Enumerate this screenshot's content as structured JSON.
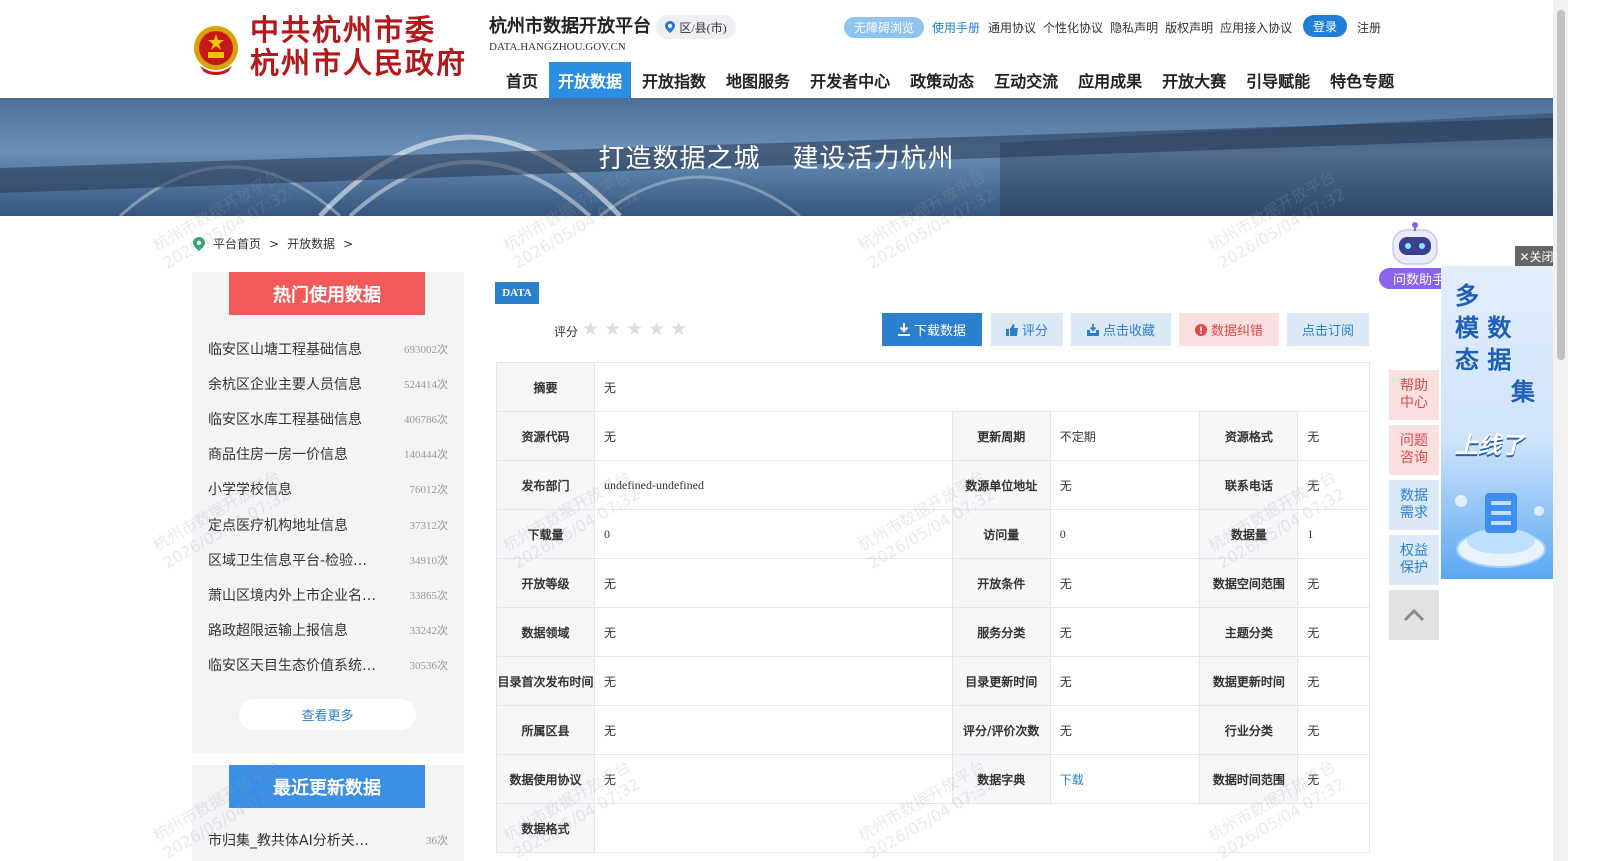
{
  "header": {
    "gov_line1": "中共杭州市委",
    "gov_line2": "杭州市人民政府",
    "platform_title": "杭州市数据开放平台",
    "platform_domain": "DATA.HANGZHOU.GOV.CN",
    "region_label": "区/县(市)",
    "accessibility": "无障碍浏览",
    "manual": "使用手册",
    "links": [
      "通用协议",
      "个性化协议",
      "隐私声明",
      "版权声明",
      "应用接入协议"
    ],
    "login": "登录",
    "register": "注册"
  },
  "nav": [
    "首页",
    "开放数据",
    "开放指数",
    "地图服务",
    "开发者中心",
    "政策动态",
    "互动交流",
    "应用成果",
    "开放大赛",
    "引导赋能",
    "特色专题"
  ],
  "banner": {
    "slogan_left": "打造数据之城",
    "slogan_right": "建设活力杭州"
  },
  "breadcrumb": [
    "平台首页",
    "开放数据"
  ],
  "hot": {
    "title": "热门使用数据",
    "items": [
      {
        "name": "临安区山塘工程基础信息",
        "count": "693002次"
      },
      {
        "name": "余杭区企业主要人员信息",
        "count": "524414次"
      },
      {
        "name": "临安区水库工程基础信息",
        "count": "406786次"
      },
      {
        "name": "商品住房一房一价信息",
        "count": "140444次"
      },
      {
        "name": "小学学校信息",
        "count": "76012次"
      },
      {
        "name": "定点医疗机构地址信息",
        "count": "37312次"
      },
      {
        "name": "区域卫生信息平台-检验…",
        "count": "34910次"
      },
      {
        "name": "萧山区境内外上市企业名…",
        "count": "33865次"
      },
      {
        "name": "路政超限运输上报信息",
        "count": "33242次"
      },
      {
        "name": "临安区天目生态价值系统…",
        "count": "30536次"
      }
    ],
    "more": "查看更多"
  },
  "recent": {
    "title": "最近更新数据",
    "first_name": "市归集_教共体AI分析关…",
    "first_count": "36次"
  },
  "main": {
    "tag": "DATA",
    "rating_label": "评分",
    "stars": 0,
    "buttons": {
      "download": "下载数据",
      "rate": "评分",
      "favorite": "点击收藏",
      "error": "数据纠错",
      "subscribe": "点击订阅"
    },
    "summary_label": "摘要",
    "summary_value": "无",
    "rows": [
      [
        [
          "资源代码",
          "无"
        ],
        [
          "更新周期",
          "不定期"
        ],
        [
          "资源格式",
          "无"
        ]
      ],
      [
        [
          "发布部门",
          "undefined-undefined"
        ],
        [
          "数源单位地址",
          "无"
        ],
        [
          "联系电话",
          "无"
        ]
      ],
      [
        [
          "下载量",
          "0"
        ],
        [
          "访问量",
          "0"
        ],
        [
          "数据量",
          "1"
        ]
      ],
      [
        [
          "开放等级",
          "无"
        ],
        [
          "开放条件",
          "无"
        ],
        [
          "数据空间范围",
          "无"
        ]
      ],
      [
        [
          "数据领域",
          "无"
        ],
        [
          "服务分类",
          "无"
        ],
        [
          "主题分类",
          "无"
        ]
      ],
      [
        [
          "目录首次发布时间",
          "无"
        ],
        [
          "目录更新时间",
          "无"
        ],
        [
          "数据更新时间",
          "无"
        ]
      ],
      [
        [
          "所属区县",
          "无"
        ],
        [
          "评分/评价次数",
          "无"
        ],
        [
          "行业分类",
          "无"
        ]
      ],
      [
        [
          "数据使用协议",
          "无"
        ],
        [
          "数据字典",
          "下载"
        ],
        [
          "数据时间范围",
          "无"
        ]
      ]
    ],
    "format_label": "数据格式"
  },
  "float": {
    "assistant": "问数助手",
    "help": "帮助中心",
    "question": "问题咨询",
    "demand": "数据需求",
    "rights": "权益保护",
    "close": "✕关闭",
    "promo_lines": [
      "多",
      "模 数",
      "态 据",
      "集"
    ],
    "promo_launch": "上线了"
  },
  "watermark": {
    "line1": "杭州市数据开放平台",
    "line2": "2026/05/04 07:32"
  },
  "colors": {
    "primary": "#2b7fcf",
    "nav_active": "#2b8ee0",
    "hot_red": "#f25a59",
    "gov_red": "#b2191c"
  }
}
